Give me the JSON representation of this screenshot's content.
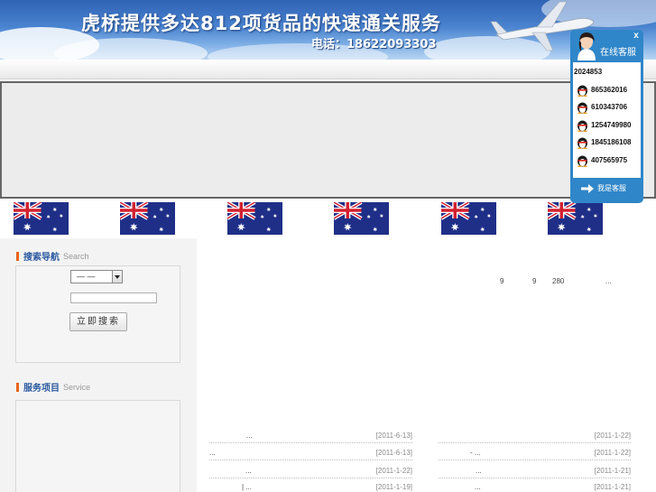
{
  "banner": {
    "title": "虎桥提供多达812项货品的快速通关服务",
    "phone": "电话：18622093303"
  },
  "left": {
    "search_section": {
      "title": "搜索导航",
      "subtitle": "Search"
    },
    "select": {
      "value": "— —"
    },
    "search_input": {
      "value": "",
      "placeholder": ""
    },
    "search_button": "立即搜索",
    "service_section": {
      "title": "服务项目",
      "subtitle": "Service"
    }
  },
  "content": {
    "intro_numbers": [
      "9",
      "9",
      "280",
      "..."
    ],
    "news_left": [
      {
        "title": "...",
        "date": "[2011-6-13]"
      },
      {
        "title": "...",
        "date": "[2011-6-13]"
      },
      {
        "title": "...",
        "date": "[2011-1-22]"
      },
      {
        "title": "| ...",
        "date": "[2011-1-19]"
      }
    ],
    "news_right": [
      {
        "title": "",
        "date": "[2011-1-22]"
      },
      {
        "title": "- ...",
        "date": "[2011-1-22]"
      },
      {
        "title": "...",
        "date": "[2011-1-21]"
      },
      {
        "title": "...",
        "date": "[2011-1-21]"
      }
    ]
  },
  "flags": {
    "count": 6,
    "icon": "australia-flag"
  },
  "customer_service": {
    "header": "在线客服",
    "close": "x",
    "contacts": [
      "2024853",
      "865362016",
      "610343706",
      "1254749980",
      "1845186108",
      "407565975"
    ],
    "footer": "我是客服",
    "icon": "qq-penguin-icon"
  },
  "colors": {
    "banner_blue": "#2f63b5",
    "section_accent": "#e8641b",
    "section_title": "#2b5aa0",
    "cs_blue": "#2f86c9"
  }
}
